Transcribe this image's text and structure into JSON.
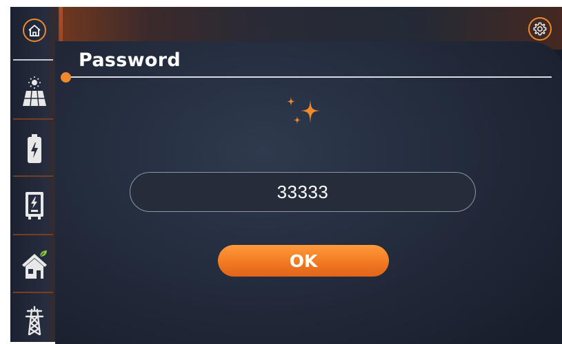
{
  "screen": {
    "title": "Password"
  },
  "password": {
    "value": "33333"
  },
  "actions": {
    "ok_label": "OK"
  },
  "sidebar": {
    "items": [
      {
        "icon": "home-icon"
      },
      {
        "icon": "solar-panel-icon"
      },
      {
        "icon": "battery-icon"
      },
      {
        "icon": "inverter-icon"
      },
      {
        "icon": "home-load-icon"
      },
      {
        "icon": "grid-tower-icon"
      }
    ]
  },
  "colors": {
    "accent": "#f08a2c",
    "background": "#1f2737",
    "field_border": "#8f97a6",
    "text": "#ffffff"
  }
}
